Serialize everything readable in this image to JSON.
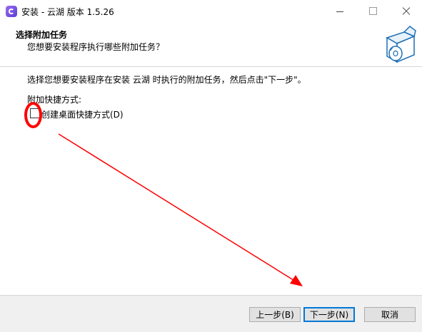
{
  "window": {
    "title": "安装 - 云湖 版本 1.5.26"
  },
  "header": {
    "title": "选择附加任务",
    "subtitle": "您想要安装程序执行哪些附加任务？"
  },
  "content": {
    "instruction": "选择您想要安装程序在安装 云湖 时执行的附加任务，然后点击\"下一步\"。",
    "group_label": "附加快捷方式:",
    "checkbox_label": "创建桌面快捷方式(D)",
    "checkbox_checked": false
  },
  "footer": {
    "back_label": "上一步(B)",
    "next_label": "下一步(N)",
    "cancel_label": "取消"
  },
  "colors": {
    "annotation": "#ff0000",
    "accent": "#0078d7"
  }
}
